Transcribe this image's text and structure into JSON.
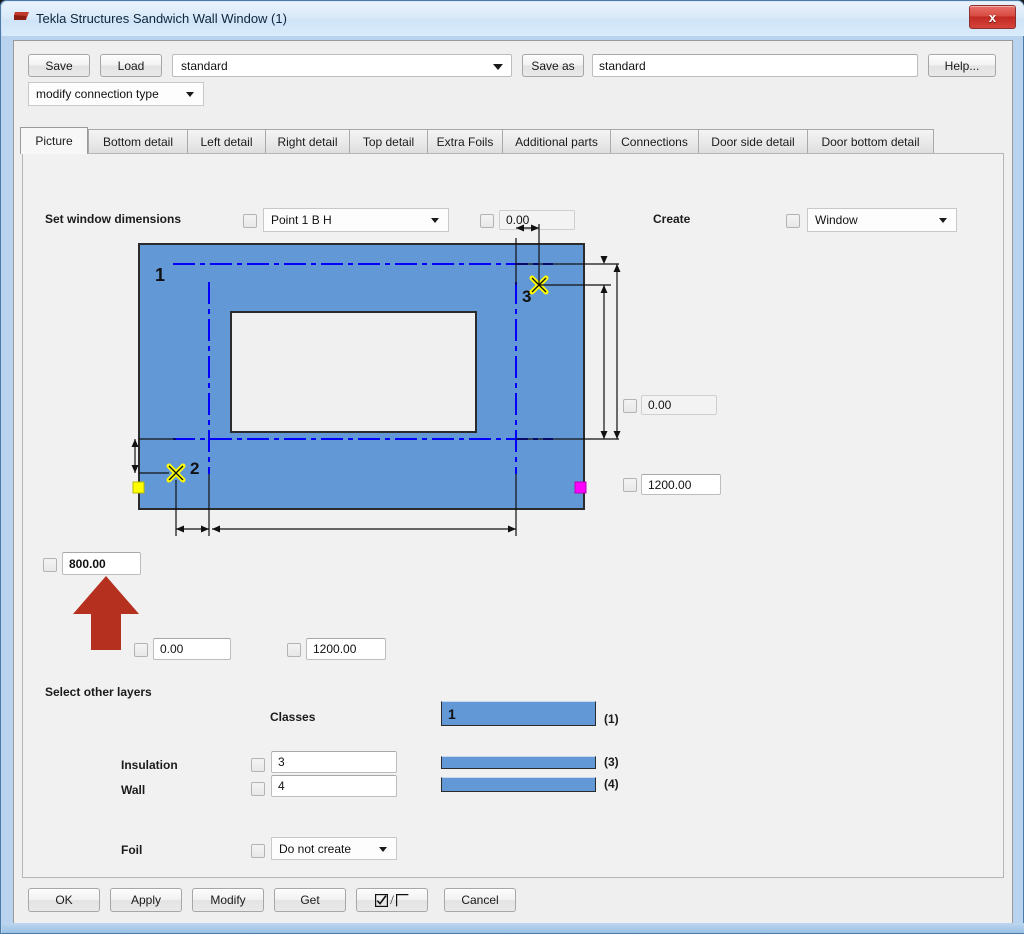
{
  "window": {
    "title": "Tekla Structures  Sandwich Wall Window (1)",
    "icon": "tekla-logo-icon",
    "close_label": "x"
  },
  "toolbar": {
    "save_label": "Save",
    "load_label": "Load",
    "standard_combo_value": "standard",
    "save_as_label": "Save as",
    "name_field_value": "standard",
    "help_label": "Help...",
    "connection_type_value": "modify connection type"
  },
  "tabs": [
    {
      "label": "Picture",
      "active": true
    },
    {
      "label": "Bottom detail",
      "active": false
    },
    {
      "label": "Left detail",
      "active": false
    },
    {
      "label": "Right detail",
      "active": false
    },
    {
      "label": "Top detail",
      "active": false
    },
    {
      "label": "Extra Foils",
      "active": false
    },
    {
      "label": "Additional parts",
      "active": false
    },
    {
      "label": "Connections",
      "active": false
    },
    {
      "label": "Door side detail",
      "active": false
    },
    {
      "label": "Door bottom detail",
      "active": false
    }
  ],
  "picture": {
    "set_window_dimensions_label": "Set window dimensions",
    "point_combo_value": "Point 1 B H",
    "top_offset_value": "0.00",
    "create_label": "Create",
    "create_combo_value": "Window",
    "right_top_value": "0.00",
    "right_height_value": "1200.00",
    "left_height_value": "800.00",
    "bottom_left_value": "0.00",
    "bottom_width_value": "1200.00",
    "markers": {
      "part_label": "1",
      "point2_label": "2",
      "point3_label": "3"
    }
  },
  "layers": {
    "section_title": "Select other layers",
    "classes_label": "Classes",
    "class_main_value": "1",
    "class_main_tag": "(1)",
    "rows": [
      {
        "label": "Insulation",
        "value": "3",
        "tag": "(3)"
      },
      {
        "label": "Wall",
        "value": "4",
        "tag": "(4)"
      }
    ],
    "foil_label": "Foil",
    "foil_combo_value": "Do not create"
  },
  "footer": {
    "ok_label": "OK",
    "apply_label": "Apply",
    "modify_label": "Modify",
    "get_label": "Get",
    "toggle_label": "/",
    "cancel_label": "Cancel"
  },
  "colors": {
    "panel_fill": "#6398d6",
    "accent_blue": "#0000ff",
    "marker_yellow": "#ffff00",
    "marker_magenta": "#ff00ff",
    "arrow_red": "#b5301f",
    "title_bar": "#d9ecfb"
  }
}
